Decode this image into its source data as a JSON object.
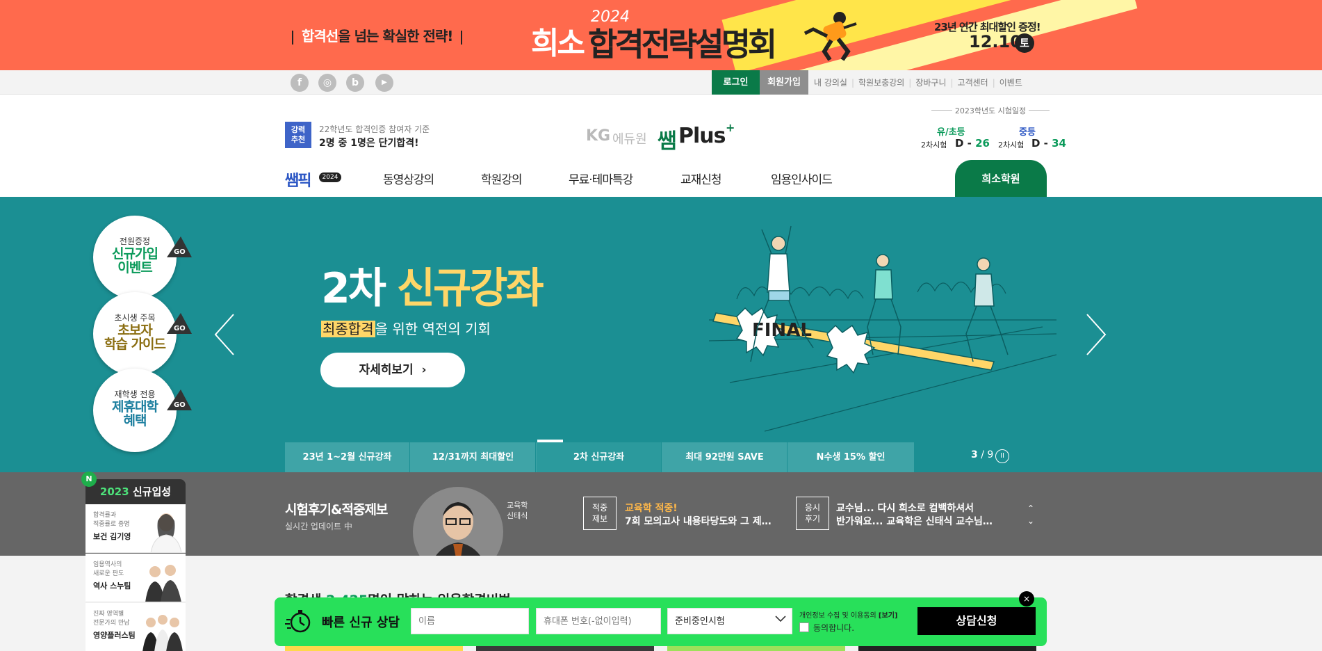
{
  "top_banner": {
    "left_pre": "합격선",
    "left_mid": "을 넘는 ",
    "left_post": "확실한 전략!",
    "year": "2024",
    "brand": "희소",
    "title": "합격전략설명회",
    "right_line1": "23년 연간 최대할인 증정!",
    "date": "12.10",
    "weekday": "토"
  },
  "util": {
    "social": [
      {
        "icon": "facebook-icon",
        "glyph": "f"
      },
      {
        "icon": "instagram-icon",
        "glyph": "◎"
      },
      {
        "icon": "blog-icon",
        "glyph": "b"
      },
      {
        "icon": "youtube-icon",
        "glyph": "▶"
      }
    ],
    "login": "로그인",
    "join": "회원가입",
    "links": [
      "내 강의실",
      "학원보충강의",
      "장바구니",
      "고객센터",
      "이벤트"
    ]
  },
  "header": {
    "badge": "강력\n추천",
    "rec_line1": "22학년도 합격인증 참여자 기준",
    "rec_line2": "2명 중 1명은 단기합격!",
    "logo_kg": "KG",
    "logo_edu": "에듀원",
    "logo_ssam": "쌤",
    "logo_plus": "Plus",
    "logo_sup": "+",
    "schedule_title": "2023학년도 시험일정",
    "schedule": [
      {
        "head": "유/초등",
        "label": "2차시험",
        "d": "D - ",
        "n": "26",
        "color": "#0a9a5a"
      },
      {
        "head": "중등",
        "label": "2차시험",
        "d": "D - ",
        "n": "34",
        "color": "#2b56c4"
      }
    ]
  },
  "nav": {
    "logo": "쌤픽",
    "logo_year": "2024",
    "items": [
      "동영상강의",
      "학원강의",
      "무료·테마특강",
      "교재신청",
      "임용인사이드"
    ],
    "hiso": "희소학원"
  },
  "quick_links": [
    {
      "small": "전원증정",
      "big1": "신규가입",
      "big2": "이벤트",
      "color": "#0a9a5a",
      "go": "GO"
    },
    {
      "small": "초시생 주목",
      "big1": "초보자",
      "big2": "학습 가이드",
      "color": "#8a6d10",
      "go": "GO"
    },
    {
      "small": "재학생 전용",
      "big1": "제휴대학",
      "big2": "혜택",
      "color": "#1d7f9f",
      "go": "GO"
    }
  ],
  "hero": {
    "title_white": "2차 ",
    "title_yellow": "신규강좌",
    "sub_hl": "최종합격",
    "sub_rest": "을 위한 역전의 기회",
    "button": "자세히보기",
    "button_arrow": "›",
    "illus_text": "FINAL",
    "tabs": [
      "23년 1~2월 신규강좌",
      "12/31까지 최대할인",
      "2차 신규강좌",
      "최대 92만원 SAVE",
      "N수생 15% 할인"
    ],
    "active_tab": 2,
    "pager_current": "3",
    "pager_sep": " / ",
    "pager_total": "9",
    "pause": "II"
  },
  "review": {
    "title": "시험후기&적중제보",
    "sub": "실시간 업데이트 中",
    "prof_line1": "교육학",
    "prof_line2": "신태식",
    "items": [
      {
        "tag": "적중\n제보",
        "head": "교육학 적중!",
        "body": "7회 모의고사 내용타당도와 그 제…",
        "head_color": "#ffb84a"
      },
      {
        "tag": "응시\n후기",
        "head": "교수님... 다시 희소로 컴백하셔서",
        "body": "반가워요... 교육학은 신태식 교수님…",
        "head_color": "#ffffff"
      }
    ]
  },
  "lower": {
    "title_pre": "합격생 ",
    "title_num": "2,425",
    "title_post": "명이 말하는 임용합격비법"
  },
  "side_panel": {
    "badge": "N",
    "head_year": "2023",
    "head_rest": " 신규입성",
    "cards": [
      {
        "small1": "합격률과",
        "small2": "적중률로 증명",
        "big": "보건 김기영"
      },
      {
        "small1": "임용역사의",
        "small2": "새로운 판도",
        "big": "역사 스누팀"
      },
      {
        "small1": "진짜 영역별",
        "small2": "전문가의 만남",
        "big": "영양플러스팀"
      }
    ]
  },
  "consult": {
    "title": "빠른 신규 상담",
    "name_placeholder": "이름",
    "phone_placeholder": "휴대폰 번호(-없이입력)",
    "select_value": "준비중인시험",
    "agree_line1": "개인정보 수집 및 이용동의 ",
    "agree_link": "[보기]",
    "agree_line2": "동의합니다.",
    "submit": "상담신청",
    "close": "×"
  },
  "colors": {
    "banner": "#ff6a4d",
    "brand_green": "#0a7a48",
    "hero_teal": "#1b8f93",
    "accent_yellow": "#ffd668",
    "consult_green": "#28e05a"
  }
}
